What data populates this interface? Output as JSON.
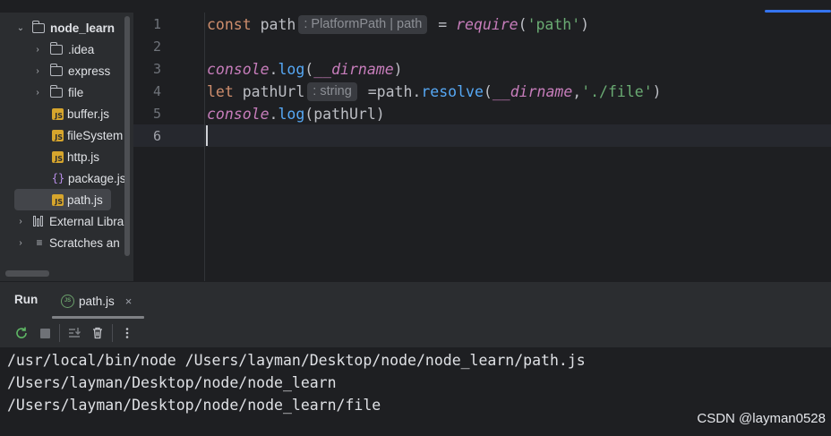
{
  "project_tree": {
    "items": [
      {
        "label": "node_learn",
        "type": "folder",
        "expanded": true,
        "icon": "folder-icon"
      },
      {
        "label": ".idea",
        "type": "folder",
        "expanded": false,
        "icon": "folder-icon"
      },
      {
        "label": "express",
        "type": "folder",
        "expanded": false,
        "icon": "folder-icon"
      },
      {
        "label": "file",
        "type": "folder",
        "expanded": false,
        "icon": "folder-icon"
      },
      {
        "label": "buffer.js",
        "type": "js",
        "icon": "js-file-icon"
      },
      {
        "label": "fileSystem",
        "type": "js",
        "icon": "js-file-icon"
      },
      {
        "label": "http.js",
        "type": "js",
        "icon": "js-file-icon"
      },
      {
        "label": "package.js",
        "type": "json",
        "icon": "json-file-icon"
      },
      {
        "label": "path.js",
        "type": "js",
        "icon": "js-file-icon",
        "selected": true
      },
      {
        "label": "External Libra",
        "type": "libraries",
        "icon": "library-icon"
      },
      {
        "label": "Scratches an",
        "type": "scratches",
        "icon": "scratches-icon"
      }
    ]
  },
  "editor": {
    "line_numbers": [
      "1",
      "2",
      "3",
      "4",
      "5",
      "6"
    ],
    "current_line": "6",
    "lines": {
      "l1": {
        "kw": "const",
        "var": " path",
        "hint": ": PlatformPath | path",
        "eq": " = ",
        "fn": "require",
        "open": "(",
        "str": "'path'",
        "close": ")"
      },
      "l3": {
        "obj": "console",
        "dot": ".",
        "method": "log",
        "open": "(",
        "glob": "__dirname",
        "close": ")"
      },
      "l4": {
        "kw": "let",
        "var": " pathUrl",
        "hint": ": string",
        "eq": " =path.",
        "method": "resolve",
        "open": "(",
        "glob": "__dirname",
        "comma": ",",
        "str": "'./file'",
        "close": ")"
      },
      "l5": {
        "obj": "console",
        "dot": ".",
        "method": "log",
        "args": "(pathUrl)"
      }
    }
  },
  "run_panel": {
    "title": "Run",
    "tab_label": "path.js",
    "tab_icon_text": "JS",
    "tab_close": "×",
    "toolbar": [
      "rerun-icon",
      "stop-icon",
      "scroll-to-end-icon",
      "clear-icon",
      "more-icon"
    ],
    "output": [
      "/usr/local/bin/node /Users/layman/Desktop/node/node_learn/path.js",
      "/Users/layman/Desktop/node/node_learn",
      "/Users/layman/Desktop/node/node_learn/file"
    ],
    "watermark": "CSDN @layman0528"
  },
  "colors": {
    "background": "#1e1f22",
    "panel": "#2b2d30",
    "keyword": "#cf8e6d",
    "string": "#6aab73",
    "method": "#56a8f5",
    "global": "#c77dbb",
    "accent": "#3574f0"
  }
}
